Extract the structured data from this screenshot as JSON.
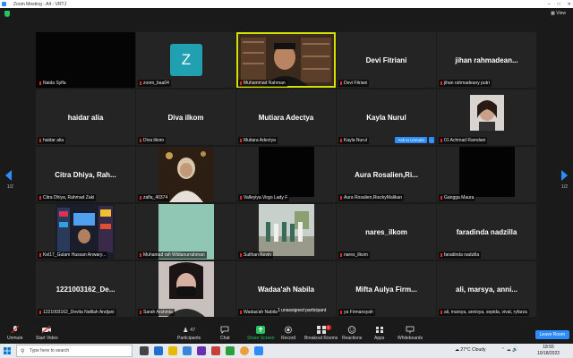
{
  "window": {
    "title": "Zoom Meeting - A4 - VRTJ",
    "view_label": "View"
  },
  "grid": {
    "page_left": "1/2",
    "page_right": "1/2",
    "tiles": [
      {
        "label": "Naida Sylfa",
        "name": ""
      },
      {
        "label": "zoom_baa04",
        "name": "",
        "avatar": "Z"
      },
      {
        "label": "Muhammad Rahman",
        "name": ""
      },
      {
        "label": "Devi Fitriani",
        "name": "Devi Fitriani"
      },
      {
        "label": "jihan rahmadeany putri",
        "name": "jihan  rahmadean..."
      },
      {
        "label": "haidar alia",
        "name": "haidar alia"
      },
      {
        "label": "Diva ilkom",
        "name": "Diva ilkom"
      },
      {
        "label": "Mutiara Adectya",
        "name": "Mutiara Adectya"
      },
      {
        "label": "Kayla Nurul",
        "name": "Kayla Nurul",
        "ask": "Ask to Unmute",
        "more": "..."
      },
      {
        "label": "01 Achmad Ramdani",
        "name": ""
      },
      {
        "label": "Citra Dhiya, Rahmad Zaki",
        "name": "Citra  Dhiya,  Rah..."
      },
      {
        "label": "zalfa_40374",
        "name": ""
      },
      {
        "label": "Valleyiya Virgo Lady F",
        "name": ""
      },
      {
        "label": "Aura Rosalien,RiezkyMalikan",
        "name": "Aura  Rosalien,Ri..."
      },
      {
        "label": "Gangga Maura",
        "name": ""
      },
      {
        "label": "Kel17_Gulam Hassan Anwary...",
        "name": ""
      },
      {
        "label": "Muhamad rafi Wildanurrahman",
        "name": ""
      },
      {
        "label": "Sulthan Kevin",
        "name": ""
      },
      {
        "label": "nares_ilkom",
        "name": "nares_ilkom"
      },
      {
        "label": "faradinda nadzilla",
        "name": "faradinda nadzilla"
      },
      {
        "label": "1221003162_Devita Nafilah Andjani",
        "name": "1221003162_De..."
      },
      {
        "label": "Sarah Arshinta",
        "name": ""
      },
      {
        "label": "Wadaa'ah Nabila",
        "name": "Wadaa'ah Nabila"
      },
      {
        "label": "ya Firmansyah",
        "name": "Mifta  Aulya  Firm..."
      },
      {
        "label": "ali, marsya, annisya, sepida, vivat, ryfarza",
        "name": "ali,  marsya,  anni..."
      }
    ]
  },
  "toast": "1 unassigned participant",
  "toolbar": {
    "unmute": "Unmute",
    "start_video": "Start Video",
    "participants": "Participants",
    "participants_count": "47",
    "chat": "Chat",
    "share": "Share Screen",
    "record": "Record",
    "breakout": "Breakout Rooms",
    "reactions": "Reactions",
    "apps": "Apps",
    "whiteboards": "Whiteboards",
    "leave": "Leave Room",
    "chat_badge": "1"
  },
  "taskbar": {
    "search_placeholder": "Type here to search",
    "weather_temp": "27°C",
    "weather_desc": "Cloudy",
    "time": "18:55",
    "date": "10/18/2022"
  },
  "colors": {
    "accent": "#2d8cff",
    "active_speaker": "#d4e000",
    "share_green": "#23c55e",
    "muted_red": "#e02828"
  }
}
